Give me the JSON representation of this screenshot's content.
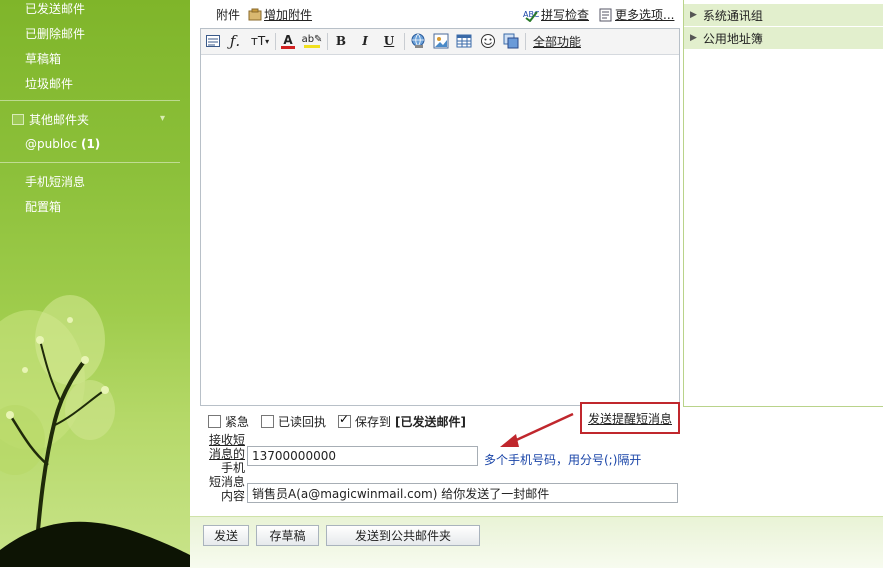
{
  "sidebar": {
    "items": [
      {
        "label": "已发送邮件"
      },
      {
        "label": "已删除邮件"
      },
      {
        "label": "草稿箱"
      },
      {
        "label": "垃圾邮件"
      }
    ],
    "other_folders_title": "其他邮件夹",
    "pub_folder": {
      "label": "@publoc",
      "count": "(1)"
    },
    "sms_item": "手机短消息",
    "config_item": "配置箱"
  },
  "topbar": {
    "attachment_label": "附件",
    "add_attachment": "增加附件",
    "spell_check": "拼写检查",
    "more_options": "更多选项..."
  },
  "toolbar": {
    "font_size": "тT",
    "all_functions": "全部功能",
    "bold": "B",
    "italic": "I",
    "underline": "U"
  },
  "contacts": {
    "groups": [
      {
        "label": "系统通讯组"
      },
      {
        "label": "公用地址簿"
      }
    ]
  },
  "options": {
    "urgent": {
      "label": "紧急",
      "checked": false
    },
    "read_receipt": {
      "label": "已读回执",
      "checked": false
    },
    "save_to": {
      "label_prefix": "保存到",
      "label_bold": "[已发送邮件]",
      "checked": true
    }
  },
  "sms": {
    "send_reminder_link": "发送提醒短消息",
    "receiver_label_line1": "接收短",
    "receiver_label_line2": "消息的",
    "content_label_line1": "手机",
    "content_label_line2": "短消息",
    "content_label_line3": "内容",
    "phone_value": "13700000000",
    "phone_hint": "多个手机号码，用分号(;)隔开",
    "content_value": "销售员A(a@magicwinmail.com) 给你发送了一封邮件"
  },
  "buttons": {
    "send": "发送",
    "save_draft": "存草稿",
    "send_to_public": "发送到公共邮件夹"
  },
  "colors": {
    "sidebar_green": "#8cc03a",
    "callout_red": "#c0272d",
    "hint_blue": "#1a45a8"
  }
}
